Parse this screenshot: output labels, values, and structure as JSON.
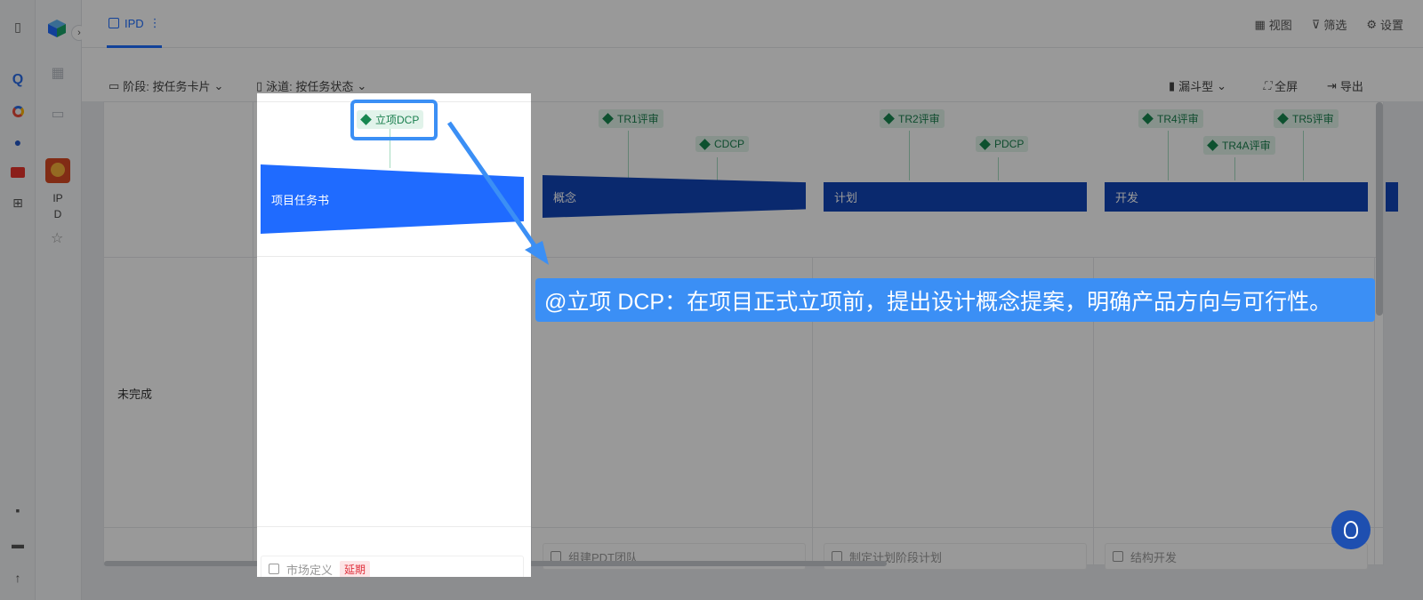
{
  "topbar": {
    "tab_label": "IPD",
    "actions": [
      "视图",
      "筛选",
      "设置"
    ]
  },
  "sidebar": {
    "project_name_line1": "IP",
    "project_name_line2": "D"
  },
  "filters": {
    "stage": "阶段: 按任务卡片",
    "lane": "泳道: 按任务状态",
    "view_type": "漏斗型",
    "fullscreen": "全屏",
    "export": "导出"
  },
  "board": {
    "lane_label": "未完成",
    "stages": [
      "项目任务书",
      "概念",
      "计划",
      "开发"
    ],
    "milestones": [
      "立项DCP",
      "TR1评审",
      "CDCP",
      "TR2评审",
      "PDCP",
      "TR4评审",
      "TR4A评审",
      "TR5评审"
    ],
    "cards": [
      {
        "title": "市场定义",
        "badge": "延期"
      },
      {
        "title": "组建PDT团队"
      },
      {
        "title": "制定计划阶段计划"
      },
      {
        "title": "结构开发"
      }
    ]
  },
  "callout": {
    "text": "@立项 DCP：在项目正式立项前，提出设计概念提案，明确产品方向与可行性。"
  },
  "colors": {
    "accent": "#1e6fff",
    "stage_active": "#1f6bff",
    "stage": "#1245b8",
    "milestone_green": "#17874f",
    "callout": "#3b8ff5",
    "late_red": "#e0303c"
  }
}
